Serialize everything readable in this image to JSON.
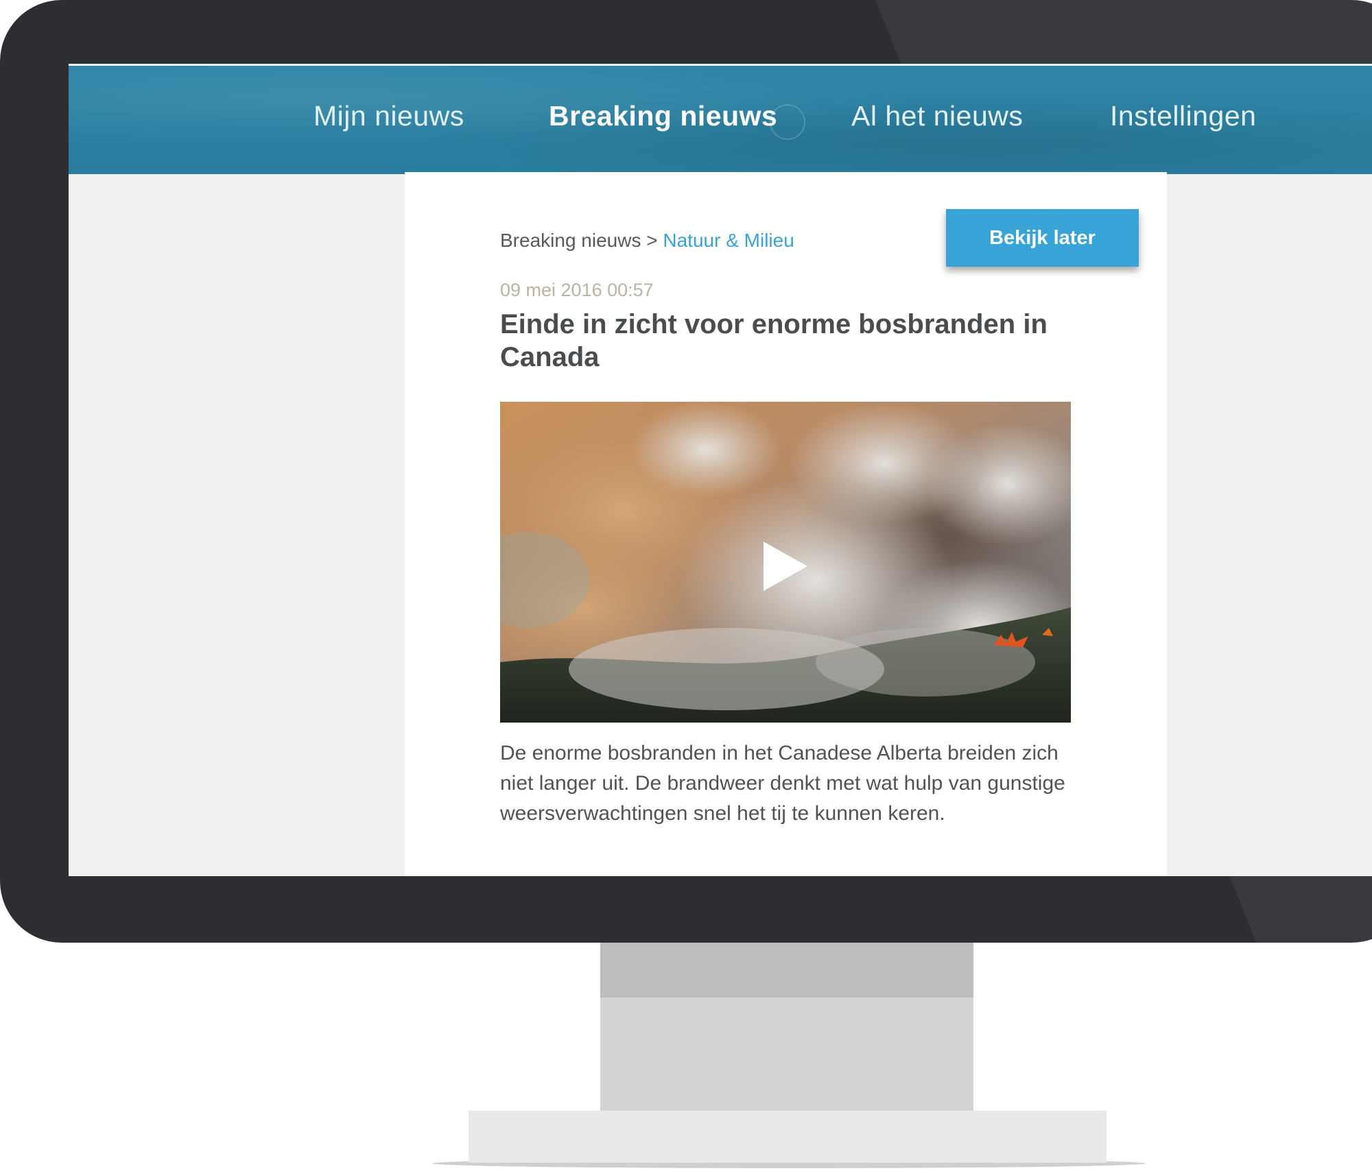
{
  "nav": {
    "items": [
      {
        "label": "Mijn nieuws"
      },
      {
        "label": "Breaking nieuws"
      },
      {
        "label": "Al het nieuws"
      },
      {
        "label": "Instellingen"
      }
    ],
    "active_index": 1,
    "background_color": "#2a7c9e"
  },
  "article": {
    "breadcrumb": {
      "root": "Breaking nieuws",
      "separator": ">",
      "current": "Natuur & Milieu"
    },
    "watch_later_label": "Bekijk later",
    "date": "09 mei 2016 00:57",
    "title": "Einde in zicht voor enorme bosbranden in Canada",
    "video_icon": "play-icon",
    "body": "De enorme bosbranden in het Canadese Alberta breiden zich niet langer uit. De brandweer denkt met wat hulp van gunstige weersverwachtingen snel het tij te kunnen keren."
  },
  "colors": {
    "accent": "#37a3d7",
    "link": "#3aa3d6",
    "bezel": "#2c2e31"
  }
}
